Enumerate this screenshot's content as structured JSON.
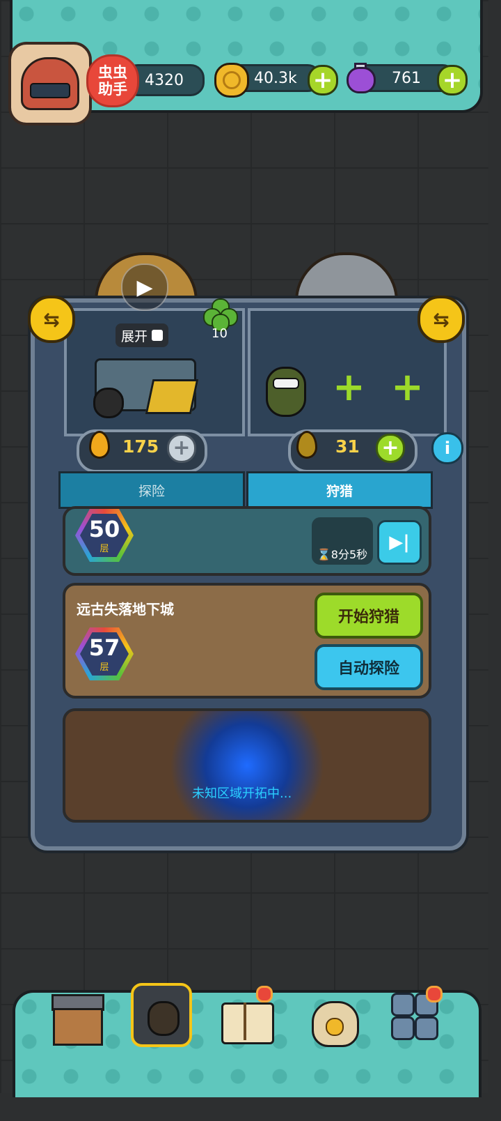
{
  "header": {
    "helper_label": "虫虫\n助手",
    "stat_value": "4320",
    "coins": "40.3k",
    "potions": "761",
    "plus": "+"
  },
  "lair": {
    "expand_label": "展开",
    "clover_count": "10",
    "left_resource": "175",
    "right_resource": "31",
    "info": "i",
    "slot_plus": "+"
  },
  "tabs": [
    {
      "label": "探险"
    },
    {
      "label": "狩猎"
    }
  ],
  "hunt_card": {
    "floor_number": "50",
    "floor_unit": "层",
    "timer": "⌛8分5秒"
  },
  "dungeon_card": {
    "name": "远古失落地下城",
    "floor_number": "57",
    "floor_unit": "层",
    "start_hunt": "开始狩猎",
    "auto_explore": "自动探险"
  },
  "unknown_area": {
    "text": "未知区域开拓中..."
  },
  "colors": {
    "teal_panel": "#5fc7bd",
    "green_button": "#9ddb2a",
    "blue_button": "#3cc6ee",
    "gold_resource": "#f0a81c"
  }
}
